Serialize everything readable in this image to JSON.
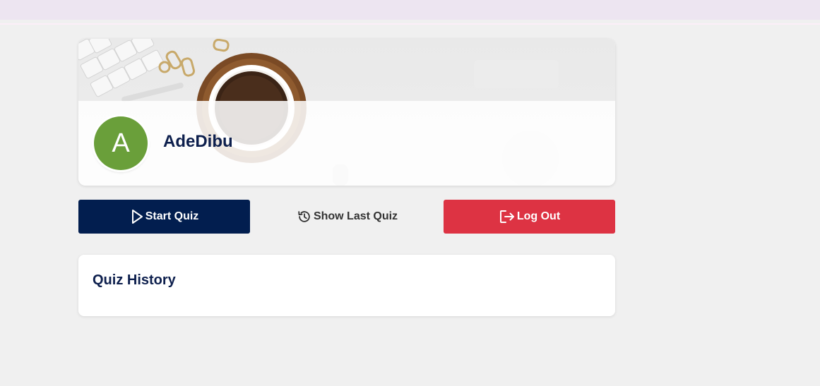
{
  "profile": {
    "avatar_letter": "A",
    "username": "AdeDibu",
    "avatar_color": "#6a9f3a"
  },
  "actions": {
    "start_label": "Start Quiz",
    "history_label": "Show Last Quiz",
    "logout_label": "Log Out"
  },
  "history": {
    "title": "Quiz History"
  },
  "colors": {
    "primary": "#021e4f",
    "danger": "#dd3343",
    "heading": "#0d1f4d",
    "background": "#f0f0f0",
    "topbar": "#ede5f1"
  },
  "icons": {
    "start": "play-icon",
    "history": "history-icon",
    "logout": "logout-icon"
  }
}
